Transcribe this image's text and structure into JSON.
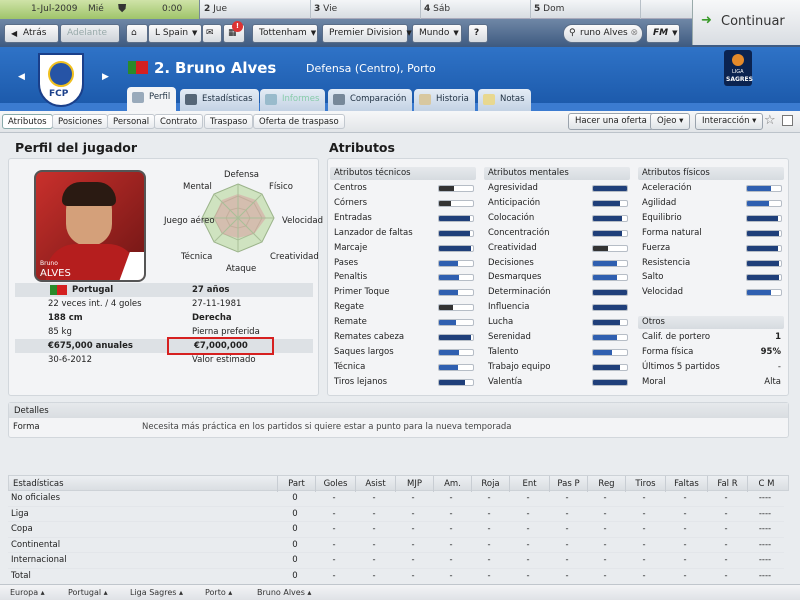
{
  "datebar": {
    "current_date": "1-Jul-2009",
    "current_day": "Mié",
    "time": "0:00",
    "days": [
      {
        "num": "2",
        "name": "Jue"
      },
      {
        "num": "3",
        "name": "Vie"
      },
      {
        "num": "4",
        "name": "Sáb"
      },
      {
        "num": "5",
        "name": "Dom"
      }
    ]
  },
  "nav": {
    "back": "Atrás",
    "forward": "Adelante",
    "country": "L Spain",
    "club": "Tottenham",
    "competition": "Premier Division",
    "world": "Mundo",
    "help": "?",
    "search_value": "runo Alves",
    "fm": "FM",
    "continue": "Continuar",
    "notification_count": "!"
  },
  "player": {
    "number": "2.",
    "name": "Bruno Alves",
    "position_club": "Defensa (Centro), Porto",
    "photo_first": "Bruno",
    "photo_last": "ALVES",
    "sponsor_line1": "LIGA",
    "sponsor_line2": "SAGRES",
    "club_badge": "FCP"
  },
  "tabs": [
    "Perfil",
    "Estadísticas",
    "Informes",
    "Comparación",
    "Historia",
    "Notas"
  ],
  "subtabs": [
    "Atributos",
    "Posiciones",
    "Personal",
    "Contrato",
    "Traspaso",
    "Oferta de traspaso"
  ],
  "actions": {
    "offer": "Hacer una oferta",
    "scout": "Ojeo",
    "interaction": "Interacción"
  },
  "profile": {
    "title": "Perfil del jugador",
    "radar_labels": [
      "Defensa",
      "Físico",
      "Velocidad",
      "Creatividad",
      "Ataque",
      "Técnica",
      "Juego aéreo",
      "Mental"
    ],
    "nation": "Portugal",
    "caps": "22 veces int. / 4 goles",
    "age": "27 años",
    "dob": "27-11-1981",
    "height": "188 cm",
    "weight": "85 kg",
    "foot": "Derecha",
    "foot_label": "Pierna preferida",
    "wage": "€675,000 anuales",
    "contract_end": "30-6-2012",
    "value": "€7,000,000",
    "value_label": "Valor estimado"
  },
  "attributes": {
    "title": "Atributos",
    "technical_title": "Atributos técnicos",
    "technical": [
      [
        "Centros",
        0.45
      ],
      [
        "Córners",
        0.35
      ],
      [
        "Entradas",
        0.9
      ],
      [
        "Lanzador de faltas",
        0.9
      ],
      [
        "Marcaje",
        0.95
      ],
      [
        "Pases",
        0.55
      ],
      [
        "Penaltis",
        0.6
      ],
      [
        "Primer Toque",
        0.55
      ],
      [
        "Regate",
        0.4
      ],
      [
        "Remate",
        0.5
      ],
      [
        "Remates cabeza",
        0.95
      ],
      [
        "Saques largos",
        0.6
      ],
      [
        "Técnica",
        0.55
      ],
      [
        "Tiros lejanos",
        0.75
      ]
    ],
    "mental_title": "Atributos mentales",
    "mental": [
      [
        "Agresividad",
        1.0
      ],
      [
        "Anticipación",
        0.8
      ],
      [
        "Colocación",
        0.85
      ],
      [
        "Concentración",
        0.85
      ],
      [
        "Creatividad",
        0.45
      ],
      [
        "Decisiones",
        0.7
      ],
      [
        "Desmarques",
        0.7
      ],
      [
        "Determinación",
        1.0
      ],
      [
        "Influencia",
        1.0
      ],
      [
        "Lucha",
        0.8
      ],
      [
        "Serenidad",
        0.7
      ],
      [
        "Talento",
        0.55
      ],
      [
        "Trabajo equipo",
        0.8
      ],
      [
        "Valentía",
        1.0
      ]
    ],
    "physical_title": "Atributos físicos",
    "physical": [
      [
        "Aceleración",
        0.7
      ],
      [
        "Agilidad",
        0.65
      ],
      [
        "Equilibrio",
        0.9
      ],
      [
        "Forma natural",
        0.95
      ],
      [
        "Fuerza",
        0.9
      ],
      [
        "Resistencia",
        0.95
      ],
      [
        "Salto",
        0.95
      ],
      [
        "Velocidad",
        0.7
      ]
    ],
    "other_title": "Otros",
    "other": [
      [
        "Calif. de portero",
        "1"
      ],
      [
        "Forma física",
        "95%"
      ],
      [
        "Últimos 5 partidos",
        "-"
      ],
      [
        "Moral",
        "Alta"
      ]
    ]
  },
  "details": {
    "title": "Detalles",
    "label": "Forma",
    "text": "Necesita más práctica en los partidos si quiere estar a punto para la nueva temporada"
  },
  "stats": {
    "headers": [
      "Estadísticas",
      "Part",
      "Goles",
      "Asist",
      "MJP",
      "Am.",
      "Roja",
      "Ent",
      "Pas P",
      "Reg",
      "Tiros",
      "Faltas",
      "Fal R",
      "C M"
    ],
    "rows": [
      [
        "No oficiales",
        "0",
        "-",
        "-",
        "-",
        "-",
        "-",
        "-",
        "-",
        "-",
        "-",
        "-",
        "-",
        "----"
      ],
      [
        "Liga",
        "0",
        "-",
        "-",
        "-",
        "-",
        "-",
        "-",
        "-",
        "-",
        "-",
        "-",
        "-",
        "----"
      ],
      [
        "Copa",
        "0",
        "-",
        "-",
        "-",
        "-",
        "-",
        "-",
        "-",
        "-",
        "-",
        "-",
        "-",
        "----"
      ],
      [
        "Continental",
        "0",
        "-",
        "-",
        "-",
        "-",
        "-",
        "-",
        "-",
        "-",
        "-",
        "-",
        "-",
        "----"
      ],
      [
        "Internacional",
        "0",
        "-",
        "-",
        "-",
        "-",
        "-",
        "-",
        "-",
        "-",
        "-",
        "-",
        "-",
        "----"
      ],
      [
        "Total",
        "0",
        "-",
        "-",
        "-",
        "-",
        "-",
        "-",
        "-",
        "-",
        "-",
        "-",
        "-",
        "----"
      ]
    ]
  },
  "breadcrumb": [
    "Europa",
    "Portugal",
    "Liga Sagres",
    "Porto",
    "Bruno Alves"
  ],
  "colors": {
    "header": "#2268b8",
    "bar_fill": "#1f3f7a",
    "bar_mid": "#2f5fb0",
    "bar_low": "#333333",
    "value_box": "#d62020"
  }
}
